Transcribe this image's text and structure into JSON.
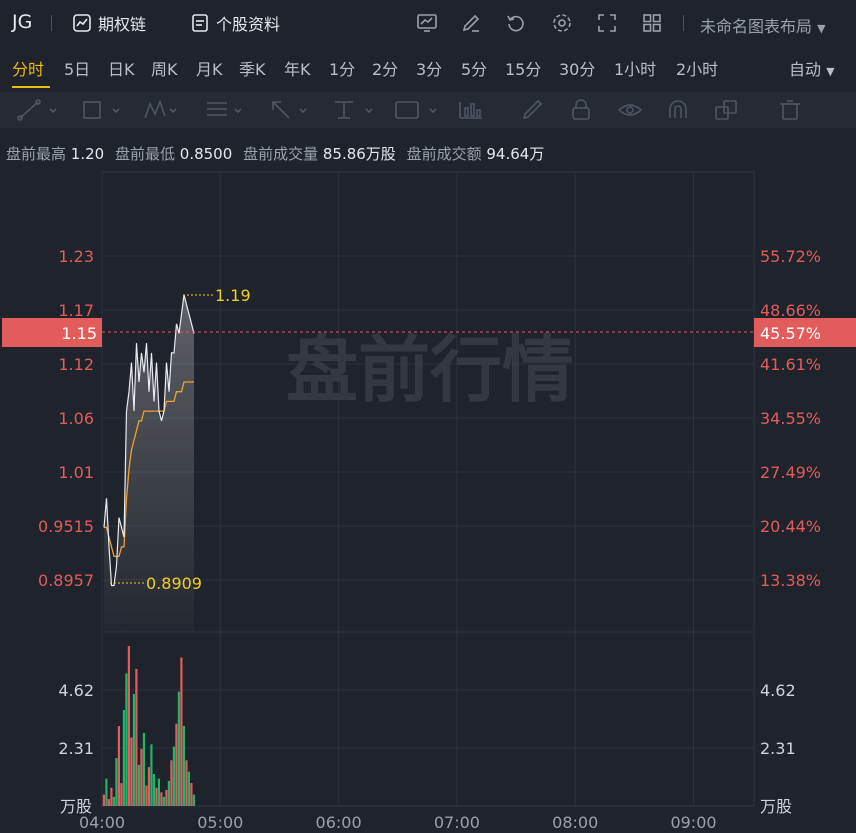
{
  "header": {
    "ticker": "JG",
    "options_chain_label": "期权链",
    "stock_profile_label": "个股资料",
    "layout_name": "未命名图表布局"
  },
  "tabs": [
    {
      "label": "分时",
      "active": true
    },
    {
      "label": "5日"
    },
    {
      "label": "日K"
    },
    {
      "label": "周K"
    },
    {
      "label": "月K"
    },
    {
      "label": "季K"
    },
    {
      "label": "年K"
    },
    {
      "label": "1分"
    },
    {
      "label": "2分"
    },
    {
      "label": "3分"
    },
    {
      "label": "5分"
    },
    {
      "label": "15分"
    },
    {
      "label": "30分"
    },
    {
      "label": "1小时"
    },
    {
      "label": "2小时"
    }
  ],
  "auto_label": "自动",
  "drawing_tools": [
    "trend-line-icon",
    "rectangle-icon",
    "pattern-icon",
    "fib-icon",
    "arrow-icon",
    "measure-icon",
    "text-icon",
    "indicator-icon",
    "pencil-icon",
    "lock-icon",
    "eye-icon",
    "magnet-icon",
    "layers-icon",
    "trash-icon"
  ],
  "premarket": {
    "high_label": "盘前最高",
    "high": "1.20",
    "low_label": "盘前最低",
    "low": "0.8500",
    "volume_label": "盘前成交量",
    "volume": "85.86万股",
    "turnover_label": "盘前成交额",
    "turnover": "94.64万"
  },
  "watermark": "盘前行情",
  "price_axis": [
    "1.23",
    "1.17",
    "1.12",
    "1.06",
    "1.01",
    "0.9515",
    "0.8957"
  ],
  "pct_axis": [
    "55.72%",
    "48.66%",
    "41.61%",
    "34.55%",
    "27.49%",
    "20.44%",
    "13.38%"
  ],
  "current_price": "1.15",
  "current_pct": "45.57%",
  "marks": {
    "high": "1.19",
    "low": "0.8909"
  },
  "volume_axis": [
    "4.62",
    "2.31"
  ],
  "volume_unit": "万股",
  "time_axis": [
    "04:00",
    "05:00",
    "06:00",
    "07:00",
    "08:00",
    "09:00"
  ],
  "colors": {
    "accent": "#f0b90b",
    "up": "#e25c5c",
    "down": "#1fb36b",
    "price_line": "#e8eaee",
    "avg_line": "#f0a030",
    "current_bg": "#e25c5c"
  },
  "chart_data": {
    "type": "line",
    "x_range": [
      "04:00",
      "09:30"
    ],
    "ylim": [
      0.85,
      1.27
    ],
    "series": [
      {
        "values": [
          0.95,
          0.98,
          0.93,
          0.89,
          0.89,
          0.91,
          0.96,
          0.95,
          0.94,
          1.07,
          1.09,
          1.12,
          1.07,
          1.14,
          1.1,
          1.13,
          1.11,
          1.14,
          1.09,
          1.13,
          1.08,
          1.12,
          1.07,
          1.06,
          1.07,
          1.12,
          1.09,
          1.13,
          1.13,
          1.16,
          1.15,
          1.17,
          1.19,
          1.18,
          1.17,
          1.16,
          1.15
        ]
      },
      {
        "values": [
          0.95,
          0.95,
          0.94,
          0.93,
          0.92,
          0.92,
          0.92,
          0.93,
          0.93,
          0.98,
          1.01,
          1.03,
          1.04,
          1.05,
          1.06,
          1.06,
          1.07,
          1.07,
          1.07,
          1.07,
          1.07,
          1.07,
          1.07,
          1.07,
          1.07,
          1.08,
          1.08,
          1.08,
          1.08,
          1.09,
          1.09,
          1.09,
          1.1,
          1.1,
          1.1,
          1.1,
          1.1
        ]
      }
    ],
    "volume": {
      "unit": "万股",
      "ylim": [
        0,
        7
      ],
      "values": [
        0.5,
        1.2,
        0.3,
        0.8,
        0.4,
        2.1,
        3.5,
        1.0,
        4.2,
        5.8,
        7.0,
        3.0,
        4.9,
        6.0,
        1.8,
        2.5,
        3.2,
        0.9,
        1.7,
        2.7,
        1.4,
        0.8,
        1.2,
        0.6,
        0.4,
        0.7,
        1.1,
        2.0,
        2.6,
        3.6,
        5.0,
        6.5,
        3.5,
        2.0,
        1.5,
        1.0,
        0.5
      ],
      "colors": [
        "up",
        "down",
        "up",
        "up",
        "down",
        "down",
        "up",
        "up",
        "down",
        "down",
        "up",
        "up",
        "down",
        "up",
        "down",
        "up",
        "down",
        "up",
        "up",
        "down",
        "down",
        "up",
        "down",
        "up",
        "down",
        "up",
        "down",
        "up",
        "down",
        "up",
        "down",
        "up",
        "down",
        "up",
        "down",
        "up",
        "down"
      ]
    }
  }
}
